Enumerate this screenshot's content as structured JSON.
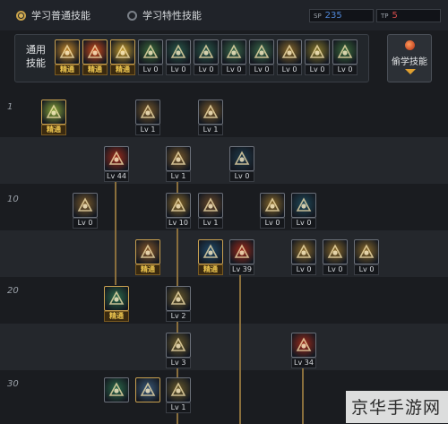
{
  "tabs": {
    "normal": "学习普通技能",
    "special": "学习特性技能"
  },
  "sp": {
    "blue_tag": "SP",
    "blue_value": "235",
    "red_tag": "TP",
    "red_value": "5"
  },
  "general": {
    "label": "通用技能",
    "skills": [
      {
        "level": "精通",
        "master": true,
        "color": "#c78a2a",
        "icon": "runner-icon"
      },
      {
        "level": "精通",
        "master": true,
        "color": "#d04a1a",
        "icon": "fire-fist-icon"
      },
      {
        "level": "精通",
        "master": true,
        "color": "#c9a030",
        "icon": "leap-icon"
      },
      {
        "level": "Lv 0",
        "master": false,
        "color": "#3a6a3a",
        "icon": "claw-icon"
      },
      {
        "level": "Lv 0",
        "master": false,
        "color": "#2a5a4a",
        "icon": "crosshair-icon"
      },
      {
        "level": "Lv 0",
        "master": false,
        "color": "#2a5a4a",
        "icon": "target-icon"
      },
      {
        "level": "Lv 0",
        "master": false,
        "color": "#3a6a4a",
        "icon": "figure-icon"
      },
      {
        "level": "Lv 0",
        "master": false,
        "color": "#3a6a4a",
        "icon": "dash-icon"
      },
      {
        "level": "Lv 0",
        "master": false,
        "color": "#8a6a2a",
        "icon": "shield-icon"
      },
      {
        "level": "Lv 0",
        "master": false,
        "color": "#8a7a2a",
        "icon": "muscle-icon"
      },
      {
        "level": "Lv 0",
        "master": false,
        "color": "#3a6a3a",
        "icon": "kick-icon"
      }
    ]
  },
  "steal_button": {
    "label": "偷学技能"
  },
  "levels": [
    "1",
    "10",
    "20",
    "30"
  ],
  "tree": [
    {
      "id": "s1",
      "level": "精通",
      "master": true,
      "color": "#8aa83a",
      "icon": "book-icon"
    },
    {
      "id": "s2",
      "level": "Lv 1",
      "master": false,
      "color": "#7a5a2a",
      "icon": "boomerang-icon"
    },
    {
      "id": "s3",
      "level": "Lv 1",
      "master": false,
      "color": "#7a5a2a",
      "icon": "throw-icon"
    },
    {
      "id": "s4",
      "level": "Lv 44",
      "master": false,
      "color": "#a02a1a",
      "icon": "burst-icon"
    },
    {
      "id": "s5",
      "level": "Lv 1",
      "master": false,
      "color": "#7a5a2a",
      "icon": "arrow-icon"
    },
    {
      "id": "s6",
      "level": "Lv 0",
      "master": false,
      "color": "#1e3a4a",
      "icon": "fish-icon"
    },
    {
      "id": "s7",
      "level": "Lv 0",
      "master": false,
      "color": "#7a5a2a",
      "icon": "curve-icon"
    },
    {
      "id": "s8",
      "level": "Lv 10",
      "master": false,
      "color": "#8a6a2a",
      "icon": "strike-icon"
    },
    {
      "id": "s9",
      "level": "Lv 1",
      "master": false,
      "color": "#6a4a2a",
      "icon": "blade-icon"
    },
    {
      "id": "s10",
      "level": "Lv 0",
      "master": false,
      "color": "#8a6a2a",
      "icon": "hand-icon"
    },
    {
      "id": "s11",
      "level": "Lv 0",
      "master": false,
      "color": "#1e4a5a",
      "icon": "face-icon"
    },
    {
      "id": "s12",
      "level": "精通",
      "master": true,
      "color": "#8a5a2a",
      "icon": "bomb-icon"
    },
    {
      "id": "s13",
      "level": "精通",
      "master": true,
      "color": "#1e4a6a",
      "icon": "gear-icon"
    },
    {
      "id": "s14",
      "level": "Lv 39",
      "master": false,
      "color": "#a02a1a",
      "icon": "flare-icon"
    },
    {
      "id": "s15",
      "level": "Lv 0",
      "master": false,
      "color": "#8a6a2a",
      "icon": "axe-icon"
    },
    {
      "id": "s16",
      "level": "Lv 0",
      "master": false,
      "color": "#8a6a2a",
      "icon": "sand-icon"
    },
    {
      "id": "s17",
      "level": "Lv 0",
      "master": false,
      "color": "#8a6a2a",
      "icon": "grenade-icon"
    },
    {
      "id": "s18",
      "level": "精通",
      "master": true,
      "color": "#2a6a4a",
      "icon": "swirl-icon"
    },
    {
      "id": "s19",
      "level": "Lv 2",
      "master": false,
      "color": "#6a5a2a",
      "icon": "scatter-icon"
    },
    {
      "id": "s20",
      "level": "Lv 3",
      "master": false,
      "color": "#6a5a2a",
      "icon": "cross-icon"
    },
    {
      "id": "s21",
      "level": "Lv 34",
      "master": false,
      "color": "#a02a1a",
      "icon": "blast-icon"
    },
    {
      "id": "s22",
      "level": "",
      "master": false,
      "color": "#2a6a4a",
      "icon": "green-orb-icon"
    },
    {
      "id": "s23",
      "level": "",
      "master": true,
      "color": "#3a5a7a",
      "icon": "swirl-blue-icon"
    },
    {
      "id": "s24",
      "level": "Lv 1",
      "master": false,
      "color": "#6a5a2a",
      "icon": "pellets-icon"
    }
  ],
  "watermark": "京华手游网"
}
